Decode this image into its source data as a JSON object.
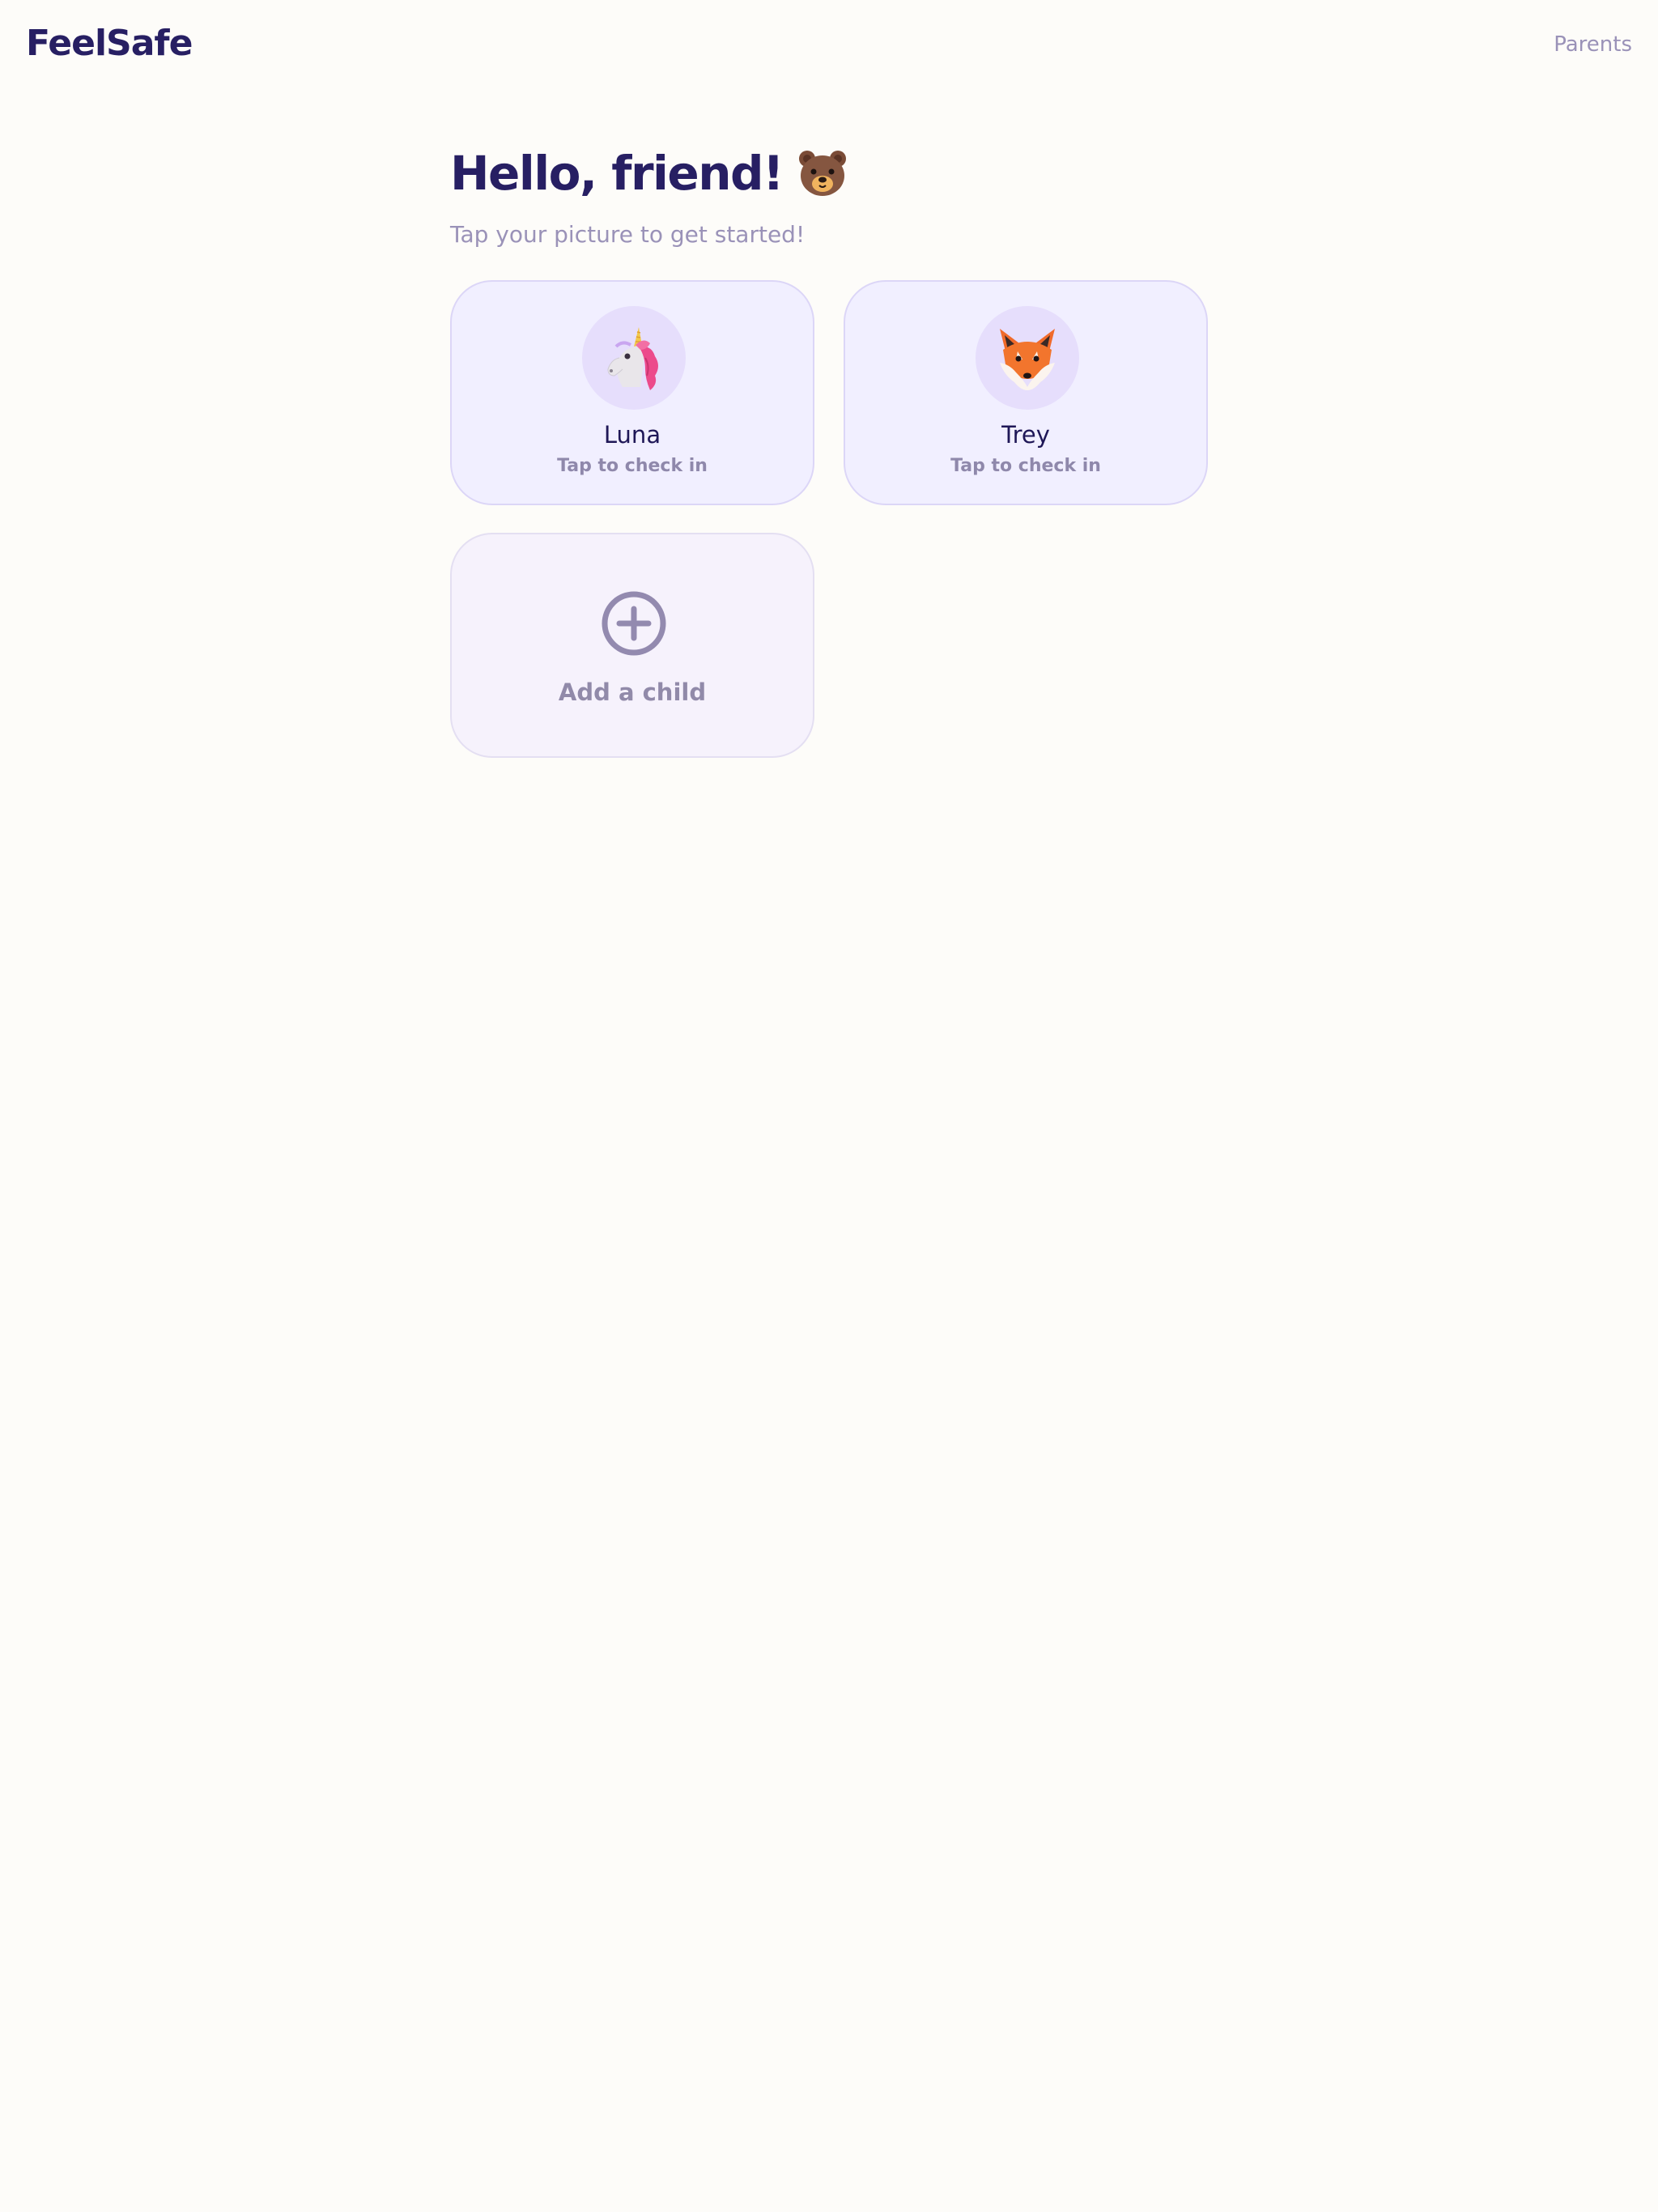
{
  "header": {
    "brand": "FeelSafe",
    "parents_link": "Parents"
  },
  "main": {
    "greeting": "Hello, friend!",
    "greeting_icon": "bear-face-icon",
    "subtitle": "Tap your picture to get started!"
  },
  "children": [
    {
      "name": "Luna",
      "hint": "Tap to check in",
      "avatar_icon": "unicorn-icon"
    },
    {
      "name": "Trey",
      "hint": "Tap to check in",
      "avatar_icon": "fox-icon"
    }
  ],
  "add_child": {
    "label": "Add a child",
    "icon": "plus-circle-icon"
  },
  "colors": {
    "background": "#fdfcf9",
    "brand": "#271f63",
    "muted": "#9a92b8",
    "card_bg": "#f1efff",
    "card_border": "#dcd6f7",
    "avatar_bg": "#e6defc"
  }
}
